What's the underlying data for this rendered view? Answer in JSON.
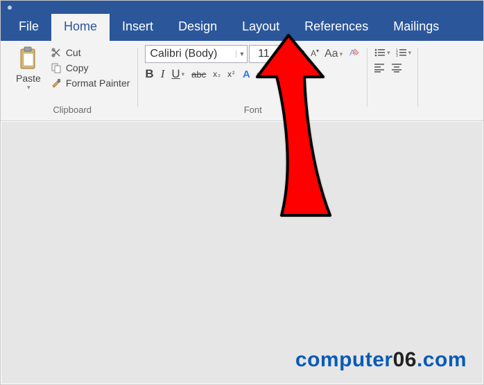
{
  "tabs": {
    "file": "File",
    "home": "Home",
    "insert": "Insert",
    "design": "Design",
    "layout": "Layout",
    "references": "References",
    "mailings": "Mailings"
  },
  "clipboard": {
    "paste": "Paste",
    "cut": "Cut",
    "copy": "Copy",
    "format_painter": "Format Painter",
    "group_label": "Clipboard"
  },
  "font": {
    "name": "Calibri (Body)",
    "size": "11",
    "bold": "B",
    "italic": "I",
    "underline": "U",
    "strike": "abc",
    "subscript": "x",
    "superscript": "x",
    "case": "Aa",
    "highlight": "ab",
    "color_letter": "A",
    "group_label": "Font"
  },
  "watermark": {
    "part1": "computer",
    "part2": "06",
    "part3": ".com"
  }
}
